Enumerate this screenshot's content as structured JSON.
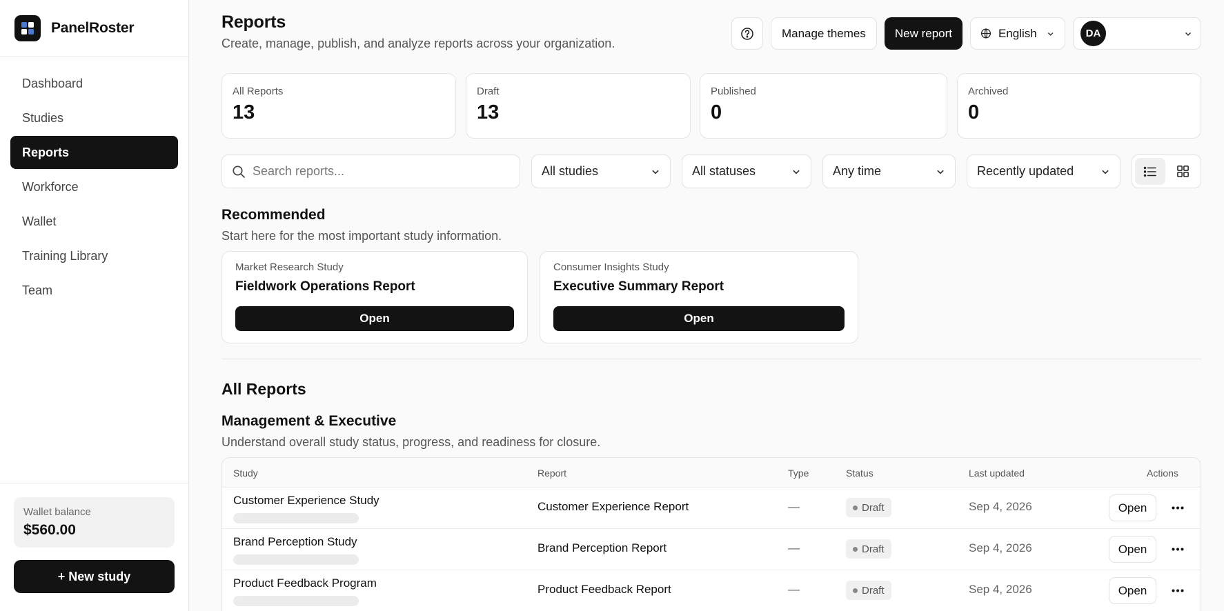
{
  "app": {
    "name": "PanelRoster"
  },
  "sidebar": {
    "items": [
      {
        "label": "Dashboard"
      },
      {
        "label": "Studies"
      },
      {
        "label": "Reports"
      },
      {
        "label": "Workforce"
      },
      {
        "label": "Wallet"
      },
      {
        "label": "Training Library"
      },
      {
        "label": "Team"
      }
    ],
    "active": "Reports",
    "wallet": {
      "label": "Wallet balance",
      "amount": "$560.00"
    },
    "new_study_label": "+ New study"
  },
  "header": {
    "title": "Reports",
    "subtitle": "Create, manage, publish, and analyze reports across your organization.",
    "manage_themes_label": "Manage themes",
    "new_report_label": "New report",
    "language": "English",
    "user_initials": "DA"
  },
  "stats": [
    {
      "label": "All Reports",
      "value": "13"
    },
    {
      "label": "Draft",
      "value": "13"
    },
    {
      "label": "Published",
      "value": "0"
    },
    {
      "label": "Archived",
      "value": "0"
    }
  ],
  "filters": {
    "search_placeholder": "Search reports...",
    "study": "All studies",
    "status": "All statuses",
    "time": "Any time",
    "sort": "Recently updated",
    "view_mode": "list"
  },
  "recommended": {
    "title": "Recommended",
    "subtitle": "Start here for the most important study information.",
    "cards": [
      {
        "study": "Market Research Study",
        "title": "Fieldwork Operations Report",
        "action": "Open"
      },
      {
        "study": "Consumer Insights Study",
        "title": "Executive Summary Report",
        "action": "Open"
      }
    ]
  },
  "all_reports": {
    "title": "All Reports",
    "group": {
      "title": "Management & Executive",
      "subtitle": "Understand overall study status, progress, and readiness for closure."
    },
    "columns": [
      "Study",
      "Report",
      "Type",
      "Status",
      "Last updated",
      "Actions"
    ],
    "rows": [
      {
        "study": "Customer Experience Study",
        "report": "Customer Experience Report",
        "type": "—",
        "status": "Draft",
        "updated": "Sep 4, 2026",
        "action": "Open"
      },
      {
        "study": "Brand Perception Study",
        "report": "Brand Perception Report",
        "type": "—",
        "status": "Draft",
        "updated": "Sep 4, 2026",
        "action": "Open"
      },
      {
        "study": "Product Feedback Program",
        "report": "Product Feedback Report",
        "type": "—",
        "status": "Draft",
        "updated": "Sep 4, 2026",
        "action": "Open"
      }
    ]
  },
  "colors": {
    "primary": "#131313",
    "background": "#fafafa",
    "border": "#e4e4e4",
    "muted": "#555555"
  }
}
